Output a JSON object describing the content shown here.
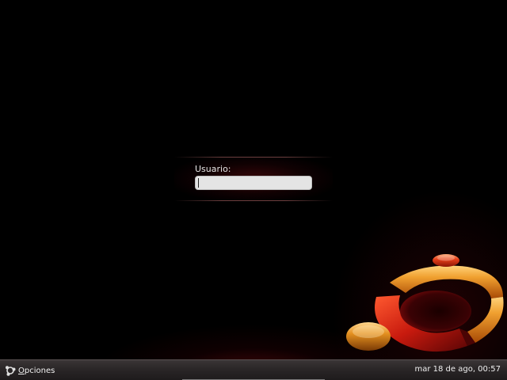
{
  "login": {
    "username_label": "Usuario:",
    "username_value": ""
  },
  "bottom_bar": {
    "options_label": "Opciones",
    "options_icon": "options-icon",
    "clock": "mar 18 de ago, 00:57"
  },
  "colors": {
    "background": "#000000",
    "panel_glow": "#4b080c",
    "logo_orange": "#e8820a",
    "logo_red": "#c81a0e",
    "bar": "#2a2627"
  }
}
